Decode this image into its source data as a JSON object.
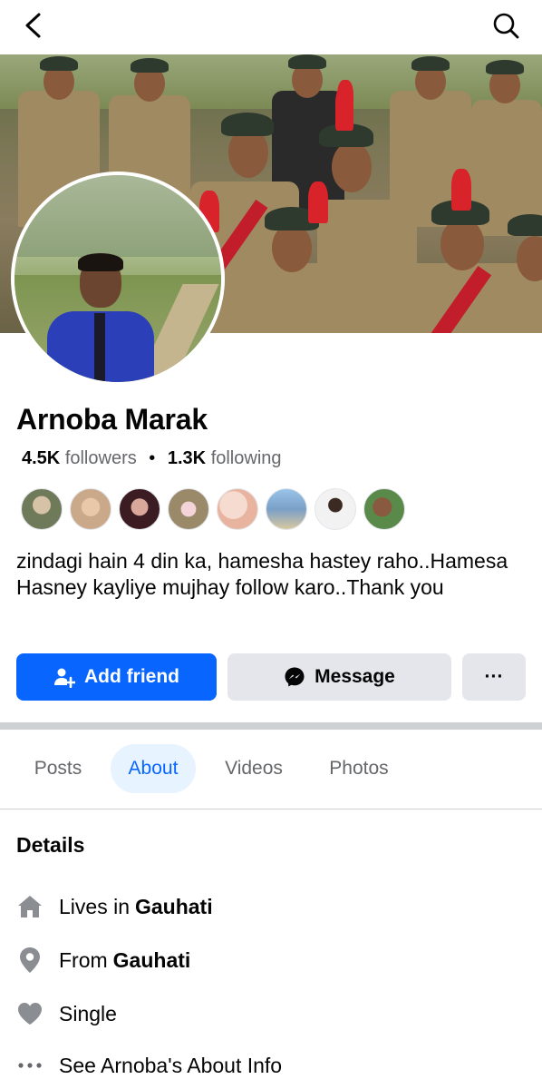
{
  "header": {
    "back_icon": "chevron-left-icon",
    "search_icon": "search-icon"
  },
  "profile": {
    "name": "Arnoba Marak",
    "followers_count": "4.5K",
    "followers_label": "followers",
    "separator": "•",
    "following_count": "1.3K",
    "following_label": "following",
    "bio": "zindagi hain 4 din ka, hamesha hastey raho..Hamesa Hasney kayliye mujhay follow karo..Thank you"
  },
  "mutual_avatars": [
    {
      "color": "#6f7a5a"
    },
    {
      "color": "#c9a98a"
    },
    {
      "color": "#8b4e5c"
    },
    {
      "color": "#9a8a6a"
    },
    {
      "color": "#e8c4b0"
    },
    {
      "color": "#7aa0c8"
    },
    {
      "color": "#d0d0d0"
    },
    {
      "color": "#5a8a4a"
    }
  ],
  "actions": {
    "add_friend": "Add friend",
    "message": "Message",
    "more": "···"
  },
  "tabs": [
    {
      "label": "Posts",
      "active": false
    },
    {
      "label": "About",
      "active": true
    },
    {
      "label": "Videos",
      "active": false
    },
    {
      "label": "Photos",
      "active": false
    }
  ],
  "details": {
    "title": "Details",
    "lives_prefix": "Lives in",
    "lives_value": "Gauhati",
    "from_prefix": "From",
    "from_value": "Gauhati",
    "relationship": "Single",
    "about_link": "See Arnoba's About Info"
  },
  "colors": {
    "accent": "#0866ff",
    "secondary_button": "#e4e6eb",
    "active_tab_bg": "#e7f3ff",
    "muted_text": "#65676b"
  }
}
